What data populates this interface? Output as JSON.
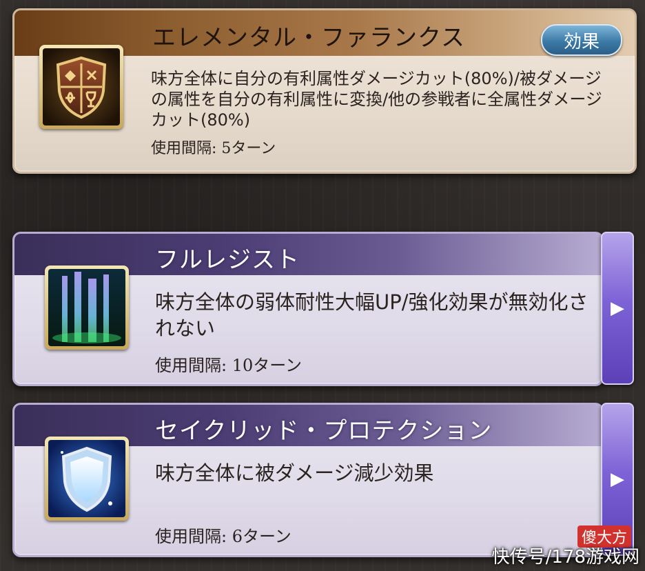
{
  "skills": [
    {
      "name": "エレメンタル・ファランクス",
      "effect_button": "効果",
      "description": "味方全体に自分の有利属性ダメージカット(80%)/被ダメージの属性を自分の有利属性に変換/他の参戦者に全属性ダメージカット(80%)",
      "interval": "使用間隔: 5ターン",
      "icon": "shield-crest-icon"
    },
    {
      "name": "フルレジスト",
      "description": "味方全体の弱体耐性大幅UP/強化効果が無効化されない",
      "interval": "使用間隔: 10ターン",
      "icon": "light-pillar-icon",
      "side_arrow": "▶"
    },
    {
      "name": "セイクリッド・プロテクション",
      "description": "味方全体に被ダメージ減少効果",
      "interval": "使用間隔: 6ターン",
      "icon": "holy-shield-icon",
      "side_arrow": "▶"
    }
  ],
  "watermark": {
    "text": "快传号/178游戏网",
    "badge": "傻大方"
  }
}
